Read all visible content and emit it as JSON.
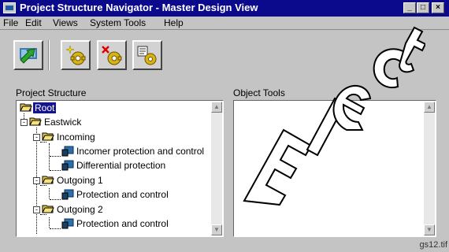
{
  "window": {
    "title": "Project Structure Navigator - Master Design View",
    "controls": {
      "minimize": "_",
      "maximize": "□",
      "close": "×"
    }
  },
  "menu": [
    {
      "label": "File",
      "icon": ""
    },
    {
      "label": "Edit"
    },
    {
      "label": "Views"
    },
    {
      "label": "System Tools"
    },
    {
      "label": "Help"
    }
  ],
  "toolbar": {
    "buttons": [
      {
        "name": "navigate-button",
        "icon": "green-arrow-network-icon"
      },
      {
        "name": "new-object-button",
        "icon": "gear-sparkle-icon"
      },
      {
        "name": "delete-object-button",
        "icon": "gear-red-x-icon"
      },
      {
        "name": "properties-button",
        "icon": "gear-document-icon"
      }
    ]
  },
  "project_structure": {
    "label": "Project Structure",
    "tree": [
      {
        "label": "Root",
        "type": "folder",
        "selected": true
      },
      {
        "label": "Eastwick",
        "type": "folder"
      },
      {
        "label": "Incoming",
        "type": "folder"
      },
      {
        "label": "Incomer protection and control",
        "type": "item"
      },
      {
        "label": "Differential protection",
        "type": "item"
      },
      {
        "label": "Outgoing 1",
        "type": "folder"
      },
      {
        "label": "Protection and control",
        "type": "item"
      },
      {
        "label": "Outgoing 2",
        "type": "folder"
      },
      {
        "label": "Protection and control",
        "type": "item"
      }
    ]
  },
  "object_tools": {
    "label": "Object Tools"
  },
  "scroll": {
    "up": "▲",
    "down": "▼"
  },
  "footer": {
    "filename": "gs12.tif"
  },
  "watermark": {
    "text": "Elect",
    "color": "#000000"
  },
  "colors": {
    "titlebar": "#0b0a8c",
    "selection": "#14148f",
    "window_bg": "#c4c4c4"
  }
}
